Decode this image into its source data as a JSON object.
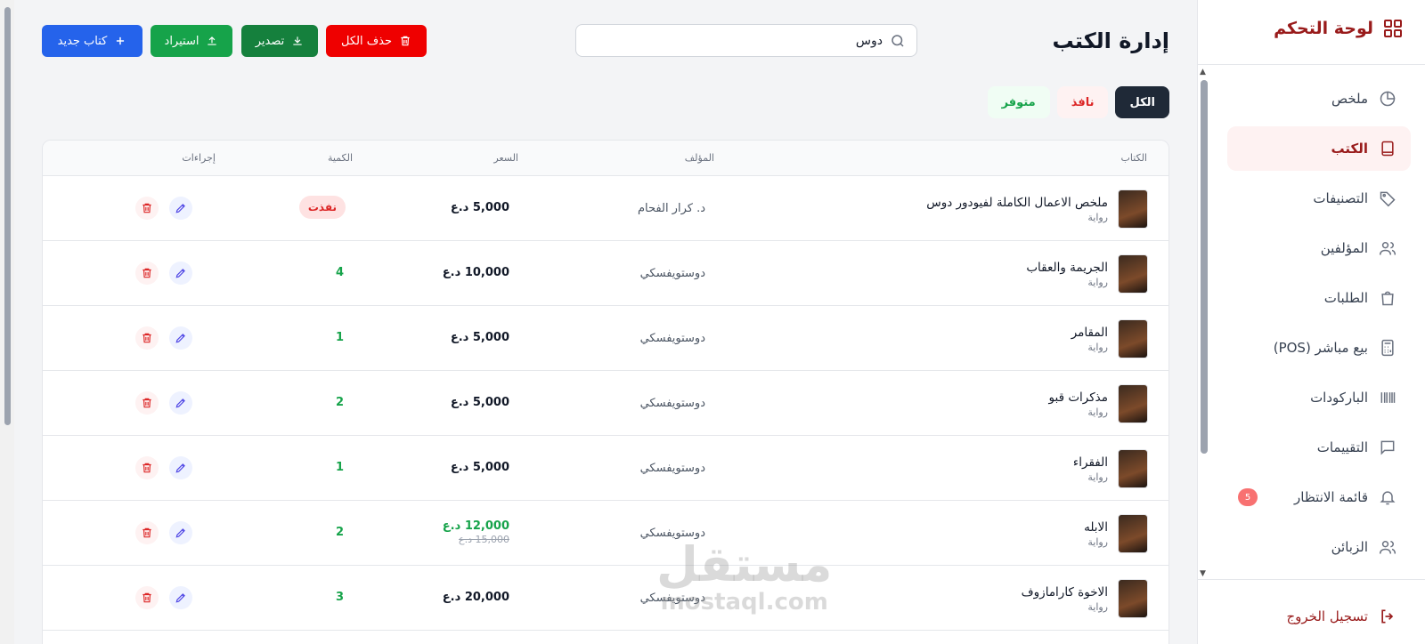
{
  "sidebar": {
    "brand": "لوحة التحكم",
    "items": [
      {
        "label": "ملخص",
        "icon": "pie-chart-icon",
        "active": false
      },
      {
        "label": "الكتب",
        "icon": "book-icon",
        "active": true
      },
      {
        "label": "التصنيفات",
        "icon": "tag-icon",
        "active": false
      },
      {
        "label": "المؤلفين",
        "icon": "users-icon",
        "active": false
      },
      {
        "label": "الطلبات",
        "icon": "shopping-bag-icon",
        "active": false
      },
      {
        "label": "بيع مباشر (POS)",
        "icon": "calculator-icon",
        "active": false
      },
      {
        "label": "الباركودات",
        "icon": "barcode-icon",
        "active": false
      },
      {
        "label": "التقييمات",
        "icon": "message-icon",
        "active": false
      },
      {
        "label": "قائمة الانتظار",
        "icon": "bell-icon",
        "active": false,
        "badge": "5"
      },
      {
        "label": "الزبائن",
        "icon": "users-icon",
        "active": false
      }
    ],
    "logout": "تسجيل الخروج"
  },
  "header": {
    "title": "إدارة الكتب",
    "search_value": "دوس",
    "buttons": {
      "delete_all": "حذف الكل",
      "export": "تصدير",
      "import": "استيراد",
      "new_book": "كتاب جديد"
    }
  },
  "filters": {
    "all": "الكل",
    "out": "نافذ",
    "available": "متوفر"
  },
  "table": {
    "columns": {
      "book": "الكتاب",
      "author": "المؤلف",
      "price": "السعر",
      "quantity": "الكمية",
      "actions": "إجراءات"
    },
    "rows": [
      {
        "title": "ملخص الاعمال الكاملة لفيودور دوس",
        "category": "رواية",
        "author": "د. كرار الفحام",
        "price": "5,000 د.ع",
        "old_price": "",
        "quantity": "نفذت",
        "out": true
      },
      {
        "title": "الجريمة والعقاب",
        "category": "رواية",
        "author": "دوستويفسكي",
        "price": "10,000 د.ع",
        "old_price": "",
        "quantity": "4",
        "out": false
      },
      {
        "title": "المقامر",
        "category": "رواية",
        "author": "دوستويفسكي",
        "price": "5,000 د.ع",
        "old_price": "",
        "quantity": "1",
        "out": false
      },
      {
        "title": "مذكرات قبو",
        "category": "رواية",
        "author": "دوستويفسكي",
        "price": "5,000 د.ع",
        "old_price": "",
        "quantity": "2",
        "out": false
      },
      {
        "title": "الفقراء",
        "category": "رواية",
        "author": "دوستويفسكي",
        "price": "5,000 د.ع",
        "old_price": "",
        "quantity": "1",
        "out": false
      },
      {
        "title": "الابله",
        "category": "رواية",
        "author": "دوستويفسكي",
        "price": "12,000 د.ع",
        "old_price": "15,000 د.ع",
        "quantity": "2",
        "out": false
      },
      {
        "title": "الاخوة كارامازوف",
        "category": "رواية",
        "author": "دوستويفسكي",
        "price": "20,000 د.ع",
        "old_price": "",
        "quantity": "3",
        "out": false
      }
    ]
  },
  "watermark": {
    "arabic": "مستقل",
    "latin": "mostaql.com"
  },
  "colors": {
    "brand": "#991b1b",
    "danger": "#ef0000",
    "success": "#16a34a",
    "primary": "#2563eb"
  }
}
